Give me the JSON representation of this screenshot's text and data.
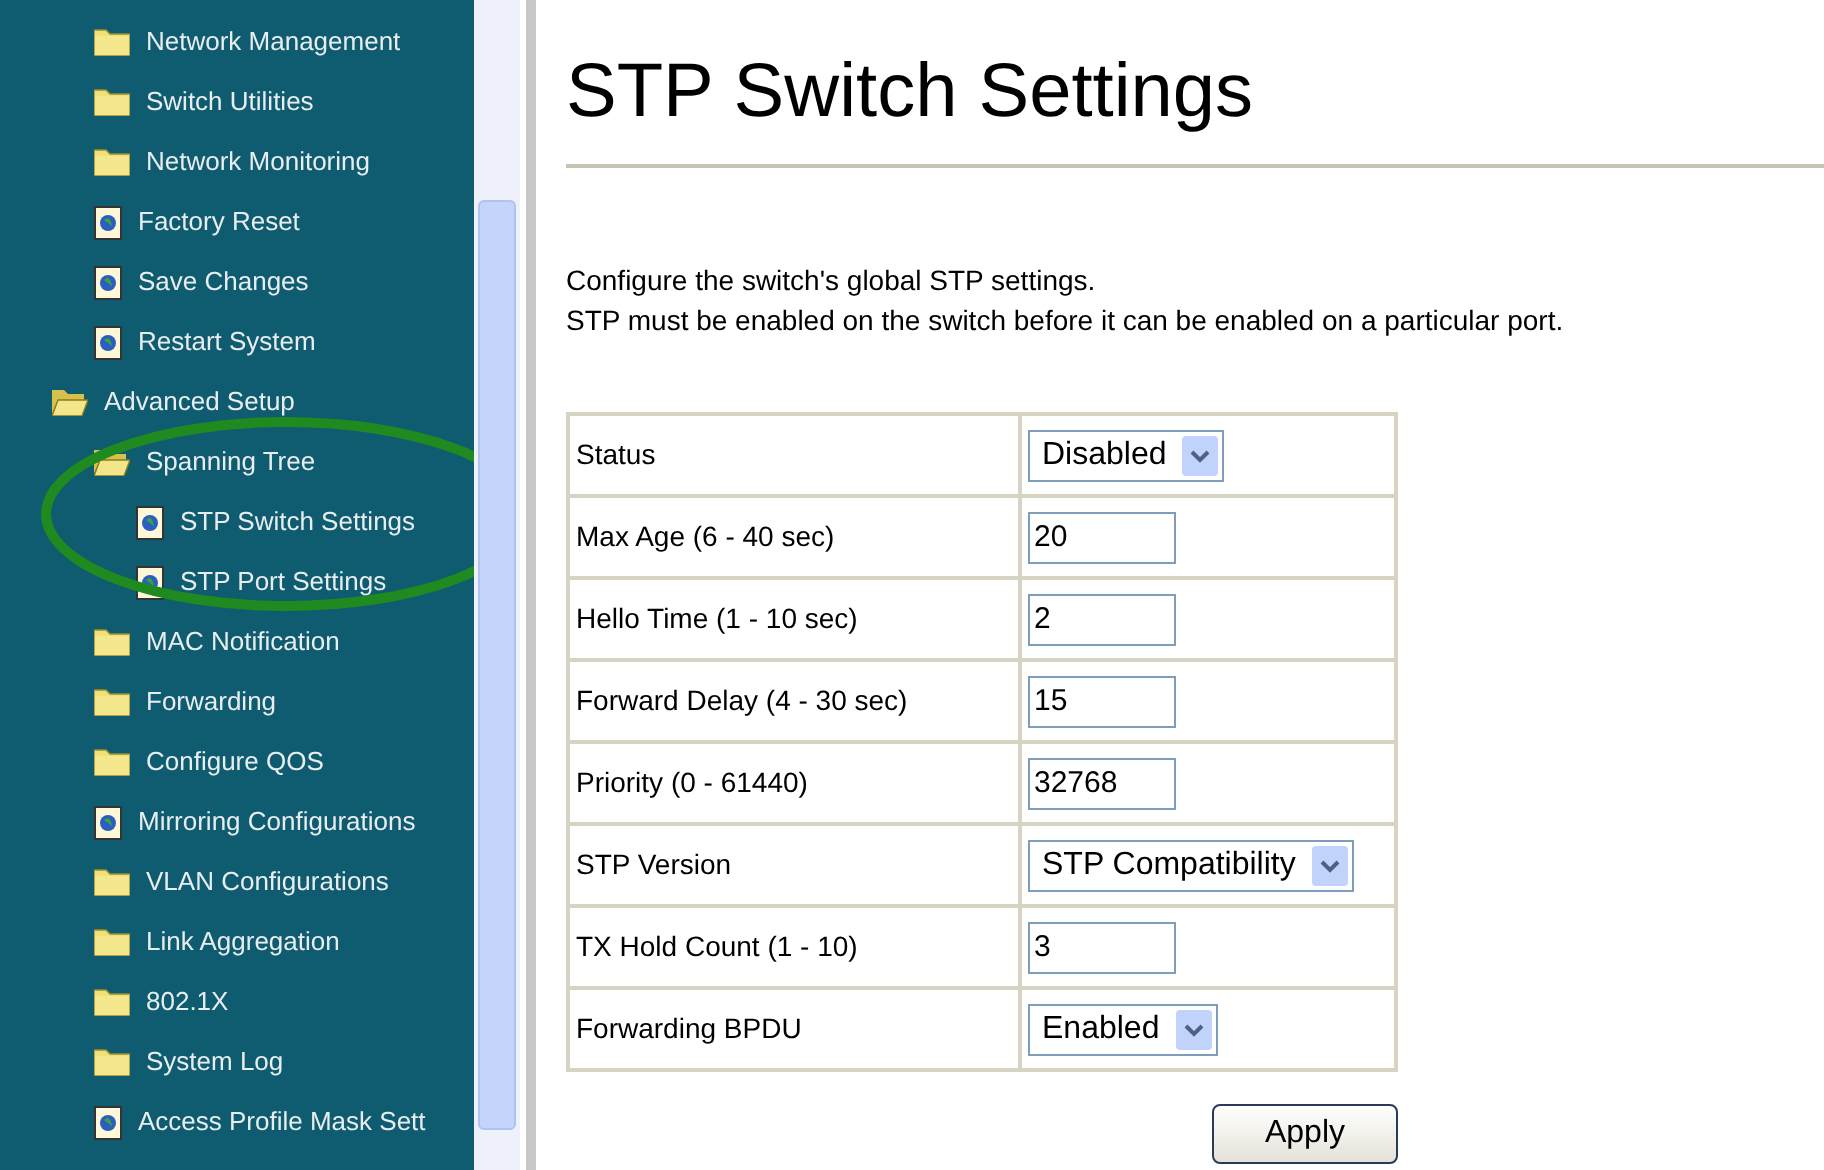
{
  "sidebar": {
    "items_above": [
      {
        "label": "Network Management",
        "kind": "folder",
        "expanded": false
      },
      {
        "label": "Switch Utilities",
        "kind": "folder",
        "expanded": false
      },
      {
        "label": "Network Monitoring",
        "kind": "folder",
        "expanded": false
      },
      {
        "label": "Factory Reset",
        "kind": "page"
      },
      {
        "label": "Save Changes",
        "kind": "page"
      },
      {
        "label": "Restart System",
        "kind": "page"
      }
    ],
    "tree": [
      {
        "label": "Advanced Setup",
        "kind": "folder",
        "expanded": true,
        "children": [
          {
            "label": "Spanning Tree",
            "kind": "folder",
            "expanded": true,
            "children": [
              {
                "label": "STP Switch Settings",
                "kind": "page"
              },
              {
                "label": "STP Port Settings",
                "kind": "page"
              }
            ]
          },
          {
            "label": "MAC Notification",
            "kind": "folder",
            "expanded": false
          },
          {
            "label": "Forwarding",
            "kind": "folder",
            "expanded": false
          },
          {
            "label": "Configure QOS",
            "kind": "folder",
            "expanded": false
          },
          {
            "label": "Mirroring Configurations",
            "kind": "page"
          },
          {
            "label": "VLAN Configurations",
            "kind": "folder",
            "expanded": false
          },
          {
            "label": "Link Aggregation",
            "kind": "folder",
            "expanded": false
          },
          {
            "label": "802.1X",
            "kind": "folder",
            "expanded": false
          },
          {
            "label": "System Log",
            "kind": "folder",
            "expanded": false
          },
          {
            "label": "Access Profile Mask Sett",
            "kind": "page"
          }
        ]
      }
    ]
  },
  "page": {
    "title": "STP Switch Settings",
    "description": [
      "Configure the switch's global STP settings.",
      "STP must be enabled on the switch before it can be enabled on a particular port."
    ],
    "settings": [
      {
        "label": "Status",
        "kind": "select",
        "value": "Disabled"
      },
      {
        "label": "Max Age (6 - 40 sec)",
        "kind": "text",
        "value": "20"
      },
      {
        "label": "Hello Time (1 - 10 sec)",
        "kind": "text",
        "value": "2"
      },
      {
        "label": "Forward Delay (4 - 30 sec)",
        "kind": "text",
        "value": "15"
      },
      {
        "label": "Priority (0 - 61440)",
        "kind": "text",
        "value": "32768"
      },
      {
        "label": "STP Version",
        "kind": "select",
        "value": "STP Compatibility"
      },
      {
        "label": "TX Hold Count (1 - 10)",
        "kind": "text",
        "value": "3"
      },
      {
        "label": "Forwarding BPDU",
        "kind": "select",
        "value": "Enabled"
      }
    ],
    "apply_button": "Apply"
  }
}
